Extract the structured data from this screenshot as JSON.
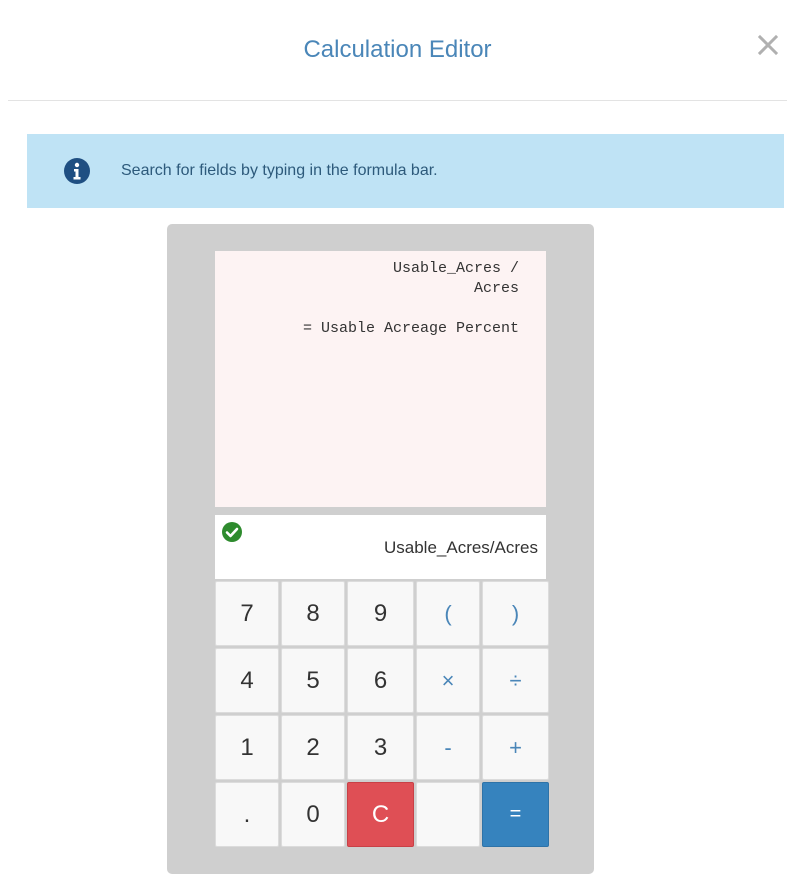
{
  "modal": {
    "title": "Calculation Editor"
  },
  "info": {
    "text": "Search for fields by typing in the formula bar."
  },
  "display": {
    "line1": "Usable_Acres /",
    "line2": "Acres",
    "result": "= Usable Acreage Percent"
  },
  "formula": {
    "text": "Usable_Acres/Acres",
    "valid": true
  },
  "keys": {
    "k7": "7",
    "k8": "8",
    "k9": "9",
    "lparen": "(",
    "rparen": ")",
    "k4": "4",
    "k5": "5",
    "k6": "6",
    "times": "×",
    "divide": "÷",
    "k1": "1",
    "k2": "2",
    "k3": "3",
    "minus": "-",
    "plus": "+",
    "dot": ".",
    "k0": "0",
    "clear": "C",
    "equals": "="
  },
  "colors": {
    "accent": "#4a86b8",
    "info_bg": "#bfe3f5",
    "clear_red": "#df4f55",
    "equals_blue": "#3683be",
    "valid_green": "#2e8b2e"
  },
  "icons": {
    "close": "close-icon",
    "info": "info-circle-icon",
    "check": "check-circle-icon"
  }
}
